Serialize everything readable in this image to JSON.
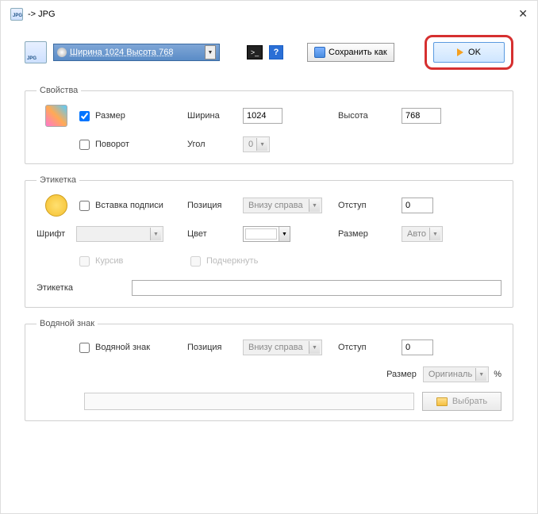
{
  "title": "-> JPG",
  "toolbar": {
    "size_preset": "Ширина 1024 Высота 768",
    "save_as": "Сохранить как",
    "ok": "OK"
  },
  "props": {
    "legend": "Свойства",
    "size_chk": "Размер",
    "width_lbl": "Ширина",
    "width_val": "1024",
    "height_lbl": "Высота",
    "height_val": "768",
    "rotate_chk": "Поворот",
    "angle_lbl": "Угол",
    "angle_val": "0"
  },
  "label": {
    "legend": "Этикетка",
    "insert_chk": "Вставка подписи",
    "pos_lbl": "Позиция",
    "pos_val": "Внизу справа",
    "indent_lbl": "Отступ",
    "indent_val": "0",
    "font_lbl": "Шрифт",
    "color_lbl": "Цвет",
    "size_lbl": "Размер",
    "size_val": "Авто",
    "italic": "Курсив",
    "underline": "Подчеркнуть",
    "text_lbl": "Этикетка"
  },
  "wm": {
    "legend": "Водяной знак",
    "chk": "Водяной знак",
    "pos_lbl": "Позиция",
    "pos_val": "Внизу справа",
    "indent_lbl": "Отступ",
    "indent_val": "0",
    "size_lbl": "Размер",
    "size_val": "Оригиналь",
    "pct": "%",
    "browse": "Выбрать"
  }
}
